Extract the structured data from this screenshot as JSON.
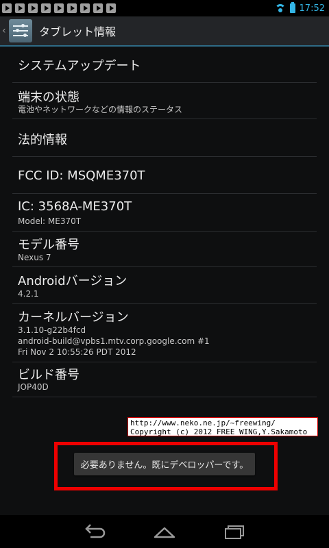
{
  "status_bar": {
    "notification_icons": [
      "play-notification-icon",
      "play-notification-icon",
      "play-notification-icon",
      "play-notification-icon",
      "play-notification-icon",
      "play-notification-icon",
      "play-notification-icon",
      "play-notification-icon",
      "play-notification-icon"
    ],
    "time": "17:52"
  },
  "action_bar": {
    "title": "タブレット情報"
  },
  "settings": {
    "rows": [
      {
        "title": "システムアップデート"
      },
      {
        "title": "端末の状態",
        "sub": "電池やネットワークなどの情報のステータス"
      },
      {
        "title": "法的情報"
      },
      {
        "title": "FCC ID: MSQME370T"
      },
      {
        "title": "IC: 3568A-ME370T",
        "sub": "Model: ME370T"
      },
      {
        "title": "モデル番号",
        "sub": "Nexus 7"
      },
      {
        "title": "Androidバージョン",
        "sub": "4.2.1"
      },
      {
        "title": "カーネルバージョン",
        "sub_lines": [
          "3.1.10-g22b4fcd",
          "android-build@vpbs1.mtv.corp.google.com #1",
          "Fri Nov 2 10:55:26 PDT 2012"
        ]
      },
      {
        "title": "ビルド番号",
        "sub": "JOP40D"
      }
    ]
  },
  "copyright": {
    "line1": "http://www.neko.ne.jp/~freewing/",
    "line2": "Copyright (c) 2012 FREE WING,Y.Sakamoto"
  },
  "toast": {
    "text": "必要ありません。既にデベロッパーです。"
  },
  "colors": {
    "accent": "#33b5e5",
    "highlight": "#ee0000"
  }
}
